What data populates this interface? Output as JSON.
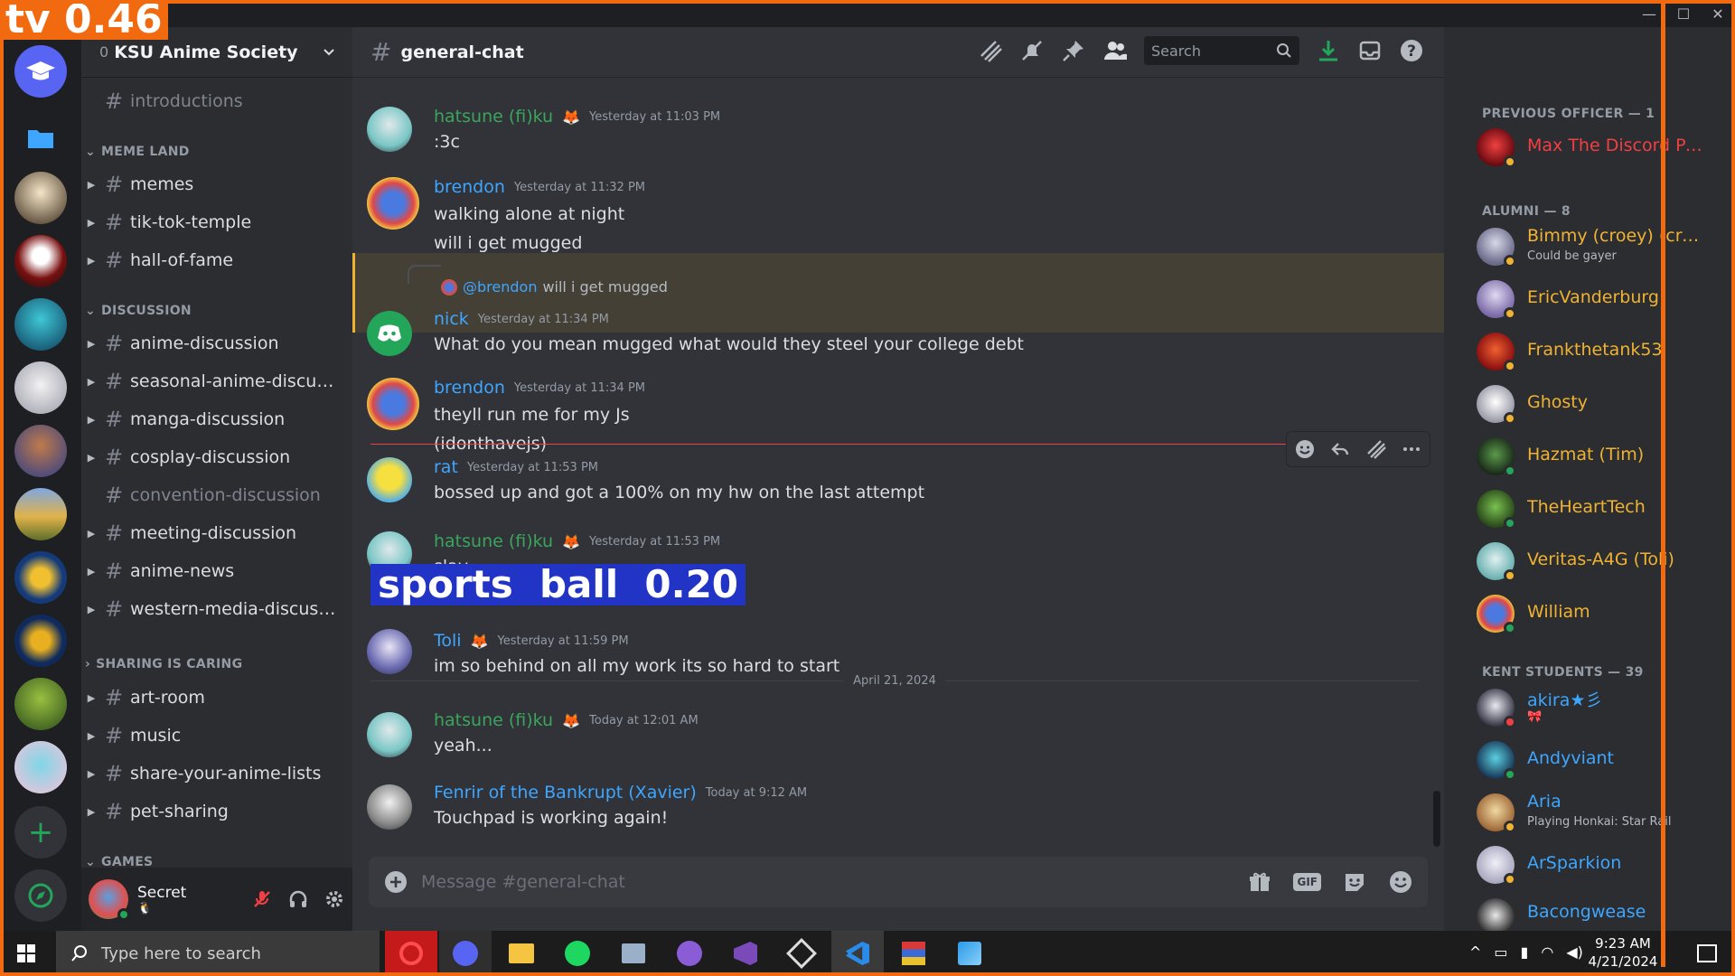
{
  "overlays": {
    "top_label": "tv 0.46",
    "mid_label": "sports  ball  0.20"
  },
  "window": {
    "min": "—",
    "max": "☐",
    "close": "✕"
  },
  "server": {
    "name": "KSU Anime Society"
  },
  "channels": {
    "introductions": "introductions",
    "cat_meme": "MEME LAND",
    "memes": "memes",
    "tiktok": "tik-tok-temple",
    "hof": "hall-of-fame",
    "cat_discussion": "DISCUSSION",
    "anime_disc": "anime-discussion",
    "seasonal": "seasonal-anime-discussi...",
    "manga": "manga-discussion",
    "cosplay": "cosplay-discussion",
    "convention": "convention-discussion",
    "meeting": "meeting-discussion",
    "news": "anime-news",
    "western": "western-media-discussi...",
    "cat_sharing": "SHARING IS CARING",
    "art": "art-room",
    "music": "music",
    "lists": "share-your-anime-lists",
    "pets": "pet-sharing",
    "cat_games": "GAMES"
  },
  "user": {
    "name": "Secret",
    "status": "🐧"
  },
  "chat": {
    "channel": "general-chat",
    "search_placeholder": "Search",
    "composer_placeholder": "Message #general-chat",
    "gif": "GIF",
    "date_divider": "April 21, 2024",
    "reply_mention": "@brendon",
    "reply_text": "will i get mugged",
    "messages": [
      {
        "user": "hatsune (fi)ku",
        "ts": "Yesterday at 11:03 PM",
        "lines": [
          ":3c"
        ]
      },
      {
        "user": "brendon",
        "ts": "Yesterday at 11:32 PM",
        "lines": [
          "walking alone at night",
          "will i get mugged"
        ]
      },
      {
        "user": "nick",
        "ts": "Yesterday at 11:34 PM",
        "lines": [
          "What do you mean mugged what would they steel your college debt"
        ]
      },
      {
        "user": "brendon",
        "ts": "Yesterday at 11:34 PM",
        "lines": [
          "theyll run me for my Js",
          "(idonthavejs)"
        ]
      },
      {
        "user": "rat",
        "ts": "Yesterday at 11:53 PM",
        "lines": [
          "bossed up and got a 100% on my hw on the last attempt"
        ]
      },
      {
        "user": "hatsune (fi)ku",
        "ts": "Yesterday at 11:53 PM",
        "lines": [
          "slay"
        ]
      },
      {
        "user": "Toli",
        "ts": "Yesterday at 11:59 PM",
        "lines": [
          "im so behind on all my work its so hard to start"
        ]
      },
      {
        "user": "hatsune (fi)ku",
        "ts": "Today at 12:01 AM",
        "lines": [
          "yeah..."
        ]
      },
      {
        "user": "Fenrir of the Bankrupt (Xavier)",
        "ts": "Today at 9:12 AM",
        "lines": [
          "Touchpad is working again!"
        ]
      }
    ]
  },
  "members": {
    "cat_prev": "PREVIOUS OFFICER — 1",
    "cat_alumni": "ALUMNI — 8",
    "cat_students": "KENT STUDENTS — 39",
    "prev": [
      {
        "name": "Max The Discord Pala..."
      }
    ],
    "alumni": [
      {
        "name": "Bimmy (croey) (croqy)...",
        "sub": "Could be gayer"
      },
      {
        "name": "EricVanderburg"
      },
      {
        "name": "Frankthetank53"
      },
      {
        "name": "Ghosty"
      },
      {
        "name": "Hazmat (Tim)"
      },
      {
        "name": "TheHeartTech"
      },
      {
        "name": "Veritas-A4G (Toli)"
      },
      {
        "name": "William"
      }
    ],
    "students": [
      {
        "name": "akira★彡",
        "sub": "🎀"
      },
      {
        "name": "Andyviant"
      },
      {
        "name": "Aria",
        "sub": "Playing Honkai: Star Rail"
      },
      {
        "name": "ArSparkion"
      },
      {
        "name": "Bacongwease"
      }
    ]
  },
  "taskbar": {
    "search_placeholder": "Type here to search",
    "time": "9:23 AM",
    "date": "4/21/2024"
  },
  "colors": {
    "accent": "#5865f2",
    "officer": "#f23f43",
    "alumni": "#f0b232",
    "student": "#3ea6ff",
    "green_user": "#3ba55c",
    "overlay_orange": "#f26a0f",
    "overlay_blue": "#2134c6"
  }
}
